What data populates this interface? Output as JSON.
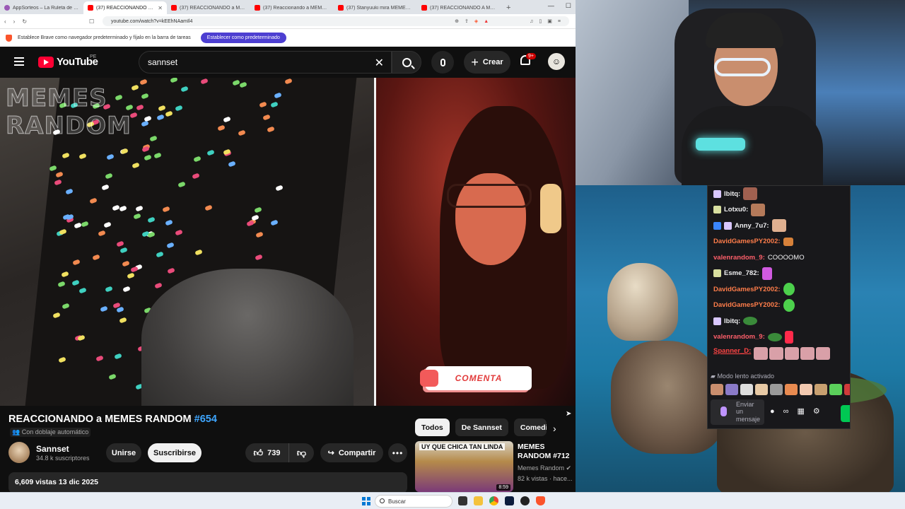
{
  "browser": {
    "tabs": [
      {
        "title": "AppSorteos – La Ruleta de la Suerte",
        "active": false
      },
      {
        "title": "(37) REACCIONANDO a MEMES",
        "active": true
      },
      {
        "title": "(37) REACCIONANDO a MEMES RA",
        "active": false
      },
      {
        "title": "(37) Reaccionando a MEMES RANDO",
        "active": false
      },
      {
        "title": "(37) Stanyuuki mira MEMES RANDO",
        "active": false
      },
      {
        "title": "(37) REACCIONANDO A MEMES RA",
        "active": false
      }
    ],
    "new_tab": "+",
    "url": "youtube.com/watch?v=kEEhNAamIl4",
    "infobar_text": "Establece Brave como navegador predeterminado y fíjalo en la barra de tareas",
    "infobar_button": "Establecer como predeterminado"
  },
  "youtube": {
    "logo_text": "YouTube",
    "country": "PE",
    "search_value": "sannset",
    "create_label": "Crear",
    "notif_count": "9+",
    "video": {
      "watermark_line1": "MEMES",
      "watermark_line2": "RANDOM",
      "overlay_button": "COMENTA"
    },
    "title_main": "REACCIONANDO a MEMES RANDOM ",
    "title_hash": "#654",
    "dubbing": "Con doblaje automático",
    "channel_name": "Sannset",
    "subscribers": "34.8 k suscriptores",
    "join_label": "Unirse",
    "subscribe_label": "Suscribirse",
    "likes": "739",
    "share_label": "Compartir",
    "more_label": "•••",
    "views_date": "6,609 vistas  13 dic 2025",
    "chips": [
      "Todos",
      "De Sannset",
      "Comedia"
    ],
    "recommendation": {
      "thumb_caption": "UY QUE CHICA TAN LINDA",
      "duration": "8:59",
      "title": "MEMES RANDOM #712",
      "channel": "Memes Random",
      "views": "82 k vistas · hace..."
    }
  },
  "chat": {
    "messages": [
      {
        "user": "lbitq:",
        "color": "#ffffff",
        "badge": "mod",
        "text": ""
      },
      {
        "user": "Lotxu0:",
        "color": "#ffffff",
        "badge": "emo",
        "text": ""
      },
      {
        "user": "Anny_7u7:",
        "color": "#ffffff",
        "badge": "blue",
        "text": ""
      },
      {
        "user": "DavidGamesPY2002:",
        "color": "#ff7d4a",
        "badge": "",
        "text": ""
      },
      {
        "user": "valenrandom_9:",
        "color": "#ff5f6a",
        "badge": "",
        "text": "COOOOMO"
      },
      {
        "user": "Esme_782:",
        "color": "#ffffff",
        "badge": "emo",
        "text": ""
      },
      {
        "user": "DavidGamesPY2002:",
        "color": "#ff7d4a",
        "badge": "",
        "text": ""
      },
      {
        "user": "DavidGamesPY2002:",
        "color": "#ff7d4a",
        "badge": "",
        "text": ""
      },
      {
        "user": "lbitq:",
        "color": "#ffffff",
        "badge": "mod",
        "text": ""
      },
      {
        "user": "valenrandom_9:",
        "color": "#ff5f6a",
        "badge": "",
        "text": ""
      },
      {
        "user": "Spanner_D:",
        "color": "#ff4444",
        "badge": "",
        "text": ""
      }
    ],
    "slow_mode": "Modo lento activado",
    "input_placeholder": "Enviar un mensaje",
    "infinity_icon": "∞"
  },
  "taskbar": {
    "search_placeholder": "Buscar"
  },
  "colors": {
    "yt_red": "#ff0033",
    "link_blue": "#3ea6ff",
    "brave_purple": "#4d3fd1",
    "twitch_bg": "#18181b"
  }
}
